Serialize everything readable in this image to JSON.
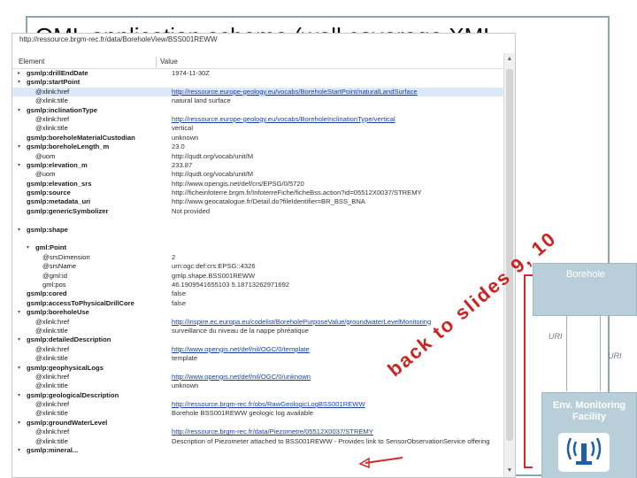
{
  "slide": {
    "title": "OML  application  schema  (well  coverage  XML"
  },
  "screenshot": {
    "url": "http://ressource.brgm-rec.fr/data/BoreholeView/BSS001REWW",
    "column_element": "Element",
    "column_value": "Value",
    "rows": [
      {
        "element": "gsmlp:drillEndDate",
        "value": "1974-11-30Z",
        "bold": true,
        "link": false,
        "toggle": "▸"
      },
      {
        "element": "gsmlp:startPoint",
        "value": "",
        "bold": true,
        "link": false,
        "toggle": "▾"
      },
      {
        "element": "@xlink:href",
        "value": "http://ressource.europe-geology.eu/vocabs/BoreholeStartPoint/naturalLandSurface",
        "bold": false,
        "link": true,
        "toggle": "",
        "highlight": true
      },
      {
        "element": "@xlink:title",
        "value": "natural land surface",
        "bold": false,
        "link": false,
        "toggle": ""
      },
      {
        "element": "gsmlp:inclinationType",
        "value": "",
        "bold": true,
        "link": false,
        "toggle": "▾"
      },
      {
        "element": "@xlink:href",
        "value": "http://ressource.europe-geology.eu/vocabs/BoreholeInclinationType/vertical",
        "bold": false,
        "link": true,
        "toggle": ""
      },
      {
        "element": "@xlink:title",
        "value": "vertical",
        "bold": false,
        "link": false,
        "toggle": ""
      },
      {
        "element": "gsmlp:boreholeMaterialCustodian",
        "value": "unknown",
        "bold": true,
        "link": false,
        "toggle": ""
      },
      {
        "element": "gsmlp:boreholeLength_m",
        "value": "23.0",
        "bold": true,
        "link": false,
        "toggle": "▾"
      },
      {
        "element": "@uom",
        "value": "http://qudt.org/vocab/unit/M",
        "bold": false,
        "link": false,
        "toggle": ""
      },
      {
        "element": "gsmlp:elevation_m",
        "value": "233.87",
        "bold": true,
        "link": false,
        "toggle": "▾"
      },
      {
        "element": "@uom",
        "value": "http://qudt.org/vocab/unit/M",
        "bold": false,
        "link": false,
        "toggle": ""
      },
      {
        "element": "gsmlp:elevation_srs",
        "value": "http://www.opengis.net/def/crs/EPSG/0/5720",
        "bold": true,
        "link": false,
        "toggle": ""
      },
      {
        "element": "gsmlp:source",
        "value": "http://ficheinfoterre.brgm.fr/InfoterreFiche/ficheBss.action?id=05512X0037/STREMY",
        "bold": true,
        "link": false,
        "toggle": ""
      },
      {
        "element": "gsmlp:metadata_uri",
        "value": "http://www.geocatalogue.fr/Detail.do?fileIdentifier=BR_BSS_BNA",
        "bold": true,
        "link": false,
        "toggle": ""
      },
      {
        "element": "gsmlp:genericSymbolizer",
        "value": "Not provided",
        "bold": true,
        "link": false,
        "toggle": ""
      },
      {
        "element": "",
        "value": "",
        "bold": false,
        "link": false,
        "toggle": ""
      },
      {
        "element": "gsmlp:shape",
        "value": "",
        "bold": true,
        "link": false,
        "toggle": "▾"
      },
      {
        "element": "",
        "value": "",
        "bold": false,
        "link": false,
        "toggle": ""
      },
      {
        "element": "gml:Point",
        "value": "",
        "bold": true,
        "link": false,
        "toggle": "▾",
        "indent": 2
      },
      {
        "element": "@srsDimension",
        "value": "2",
        "bold": false,
        "link": false,
        "toggle": "",
        "indent": 3
      },
      {
        "element": "@srsName",
        "value": "urn:ogc:def:crs:EPSG::4326",
        "bold": false,
        "link": false,
        "toggle": "",
        "indent": 3
      },
      {
        "element": "@gml:id",
        "value": "gmlp.shape.BSS001REWW",
        "bold": false,
        "link": false,
        "toggle": "",
        "indent": 3
      },
      {
        "element": "gml:pos",
        "value": "46.1909541655103 5.18713262971692",
        "bold": false,
        "link": false,
        "toggle": "",
        "indent": 3
      },
      {
        "element": "gsmlp:cored",
        "value": "false",
        "bold": true,
        "link": false,
        "toggle": ""
      },
      {
        "element": "gsmlp:accessToPhysicalDrillCore",
        "value": "false",
        "bold": true,
        "link": false,
        "toggle": ""
      },
      {
        "element": "gsmlp:boreholeUse",
        "value": "",
        "bold": true,
        "link": false,
        "toggle": "▾"
      },
      {
        "element": "@xlink:href",
        "value": "http://inspire.ec.europa.eu/codelist/BoreholePurposeValue/groundwaterLevelMonitoring",
        "bold": false,
        "link": true,
        "toggle": ""
      },
      {
        "element": "@xlink:title",
        "value": "surveillance du niveau de la nappe phréatique",
        "bold": false,
        "link": false,
        "toggle": ""
      },
      {
        "element": "gsmlp:detailedDescription",
        "value": "",
        "bold": true,
        "link": false,
        "toggle": "▾"
      },
      {
        "element": "@xlink:href",
        "value": "http://www.opengis.net/def/nil/OGC/0/template",
        "bold": false,
        "link": true,
        "toggle": ""
      },
      {
        "element": "@xlink:title",
        "value": "template",
        "bold": false,
        "link": false,
        "toggle": ""
      },
      {
        "element": "gsmlp:geophysicalLogs",
        "value": "",
        "bold": true,
        "link": false,
        "toggle": "▾"
      },
      {
        "element": "@xlink:href",
        "value": "http://www.opengis.net/def/nil/OGC/0/unknown",
        "bold": false,
        "link": true,
        "toggle": ""
      },
      {
        "element": "@xlink:title",
        "value": "unknown",
        "bold": false,
        "link": false,
        "toggle": ""
      },
      {
        "element": "gsmlp:geologicalDescription",
        "value": "",
        "bold": true,
        "link": false,
        "toggle": "▾"
      },
      {
        "element": "@xlink:href",
        "value": "http://ressource.brgm-rec.fr/obs/RawGeologicLogBSS001REWW",
        "bold": false,
        "link": true,
        "toggle": ""
      },
      {
        "element": "@xlink:title",
        "value": "Borehole BSS001REWW geologic log available",
        "bold": false,
        "link": false,
        "toggle": ""
      },
      {
        "element": "gsmlp:groundWaterLevel",
        "value": "",
        "bold": true,
        "link": false,
        "toggle": "▾"
      },
      {
        "element": "@xlink:href",
        "value": "http://ressource.brgm-rec.fr/data/Piezometre/05512X0037/STREMY",
        "bold": false,
        "link": true,
        "toggle": ""
      },
      {
        "element": "@xlink:title",
        "value": "Description of Piezometer attached to BSS001REWW - Provides link to SensorObservationService offering",
        "bold": false,
        "link": false,
        "toggle": ""
      },
      {
        "element": "gsmlp:mineral...",
        "value": "",
        "bold": true,
        "link": false,
        "toggle": "▾"
      }
    ]
  },
  "diagram": {
    "borehole_label": "Borehole",
    "uri_label_left": "URI",
    "uri_label_right": "URI",
    "env_label": "Env. Monitoring Facility",
    "back_to_slides": "back to slides 9, 10",
    "sensor_icon": "antenna-tower-icon"
  }
}
